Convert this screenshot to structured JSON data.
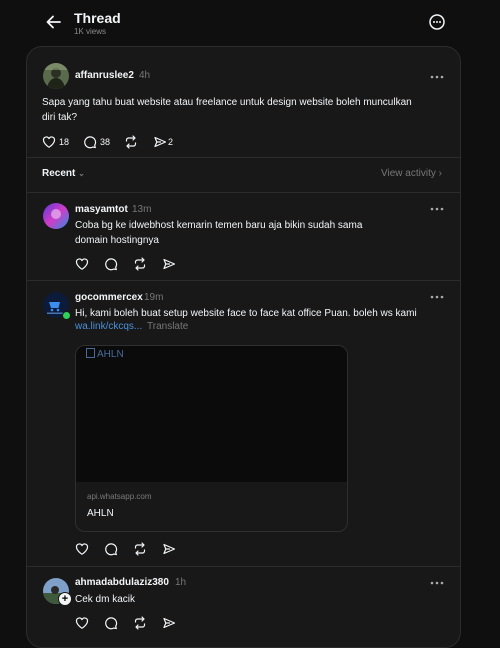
{
  "header": {
    "title": "Thread",
    "views": "1K views"
  },
  "main_post": {
    "username": "affanruslee2",
    "time": "4h",
    "text_line1": "Sapa yang tahu buat website atau freelance untuk design website boleh munculkan",
    "text_line2": "diri tak?",
    "likes": "18",
    "comments": "38",
    "shares": "2"
  },
  "sort": {
    "label": "Recent",
    "view_activity": "View activity"
  },
  "replies": [
    {
      "username": "masyamtot",
      "time": "13m",
      "text_line1": "Coba bg ke idwebhost kemarin temen baru aja bikin sudah sama",
      "text_line2": "domain hostingnya"
    },
    {
      "username": "gocommercex",
      "time": "19m",
      "text_line1": "Hi, kami boleh buat setup website face to face kat office Puan. boleh ws kami",
      "link": "wa.link/ckcqs...",
      "translate": "Translate",
      "card": {
        "image_alt": "AHLN",
        "domain": "api.whatsapp.com",
        "title": "AHLN"
      }
    },
    {
      "username": "ahmadabdulaziz380",
      "time": "1h",
      "text_line1": "Cek dm kacik"
    }
  ],
  "colors": {
    "background": "#0f0f0f",
    "panel": "#181818",
    "online": "#2fd15a",
    "link": "#4a91d9"
  }
}
